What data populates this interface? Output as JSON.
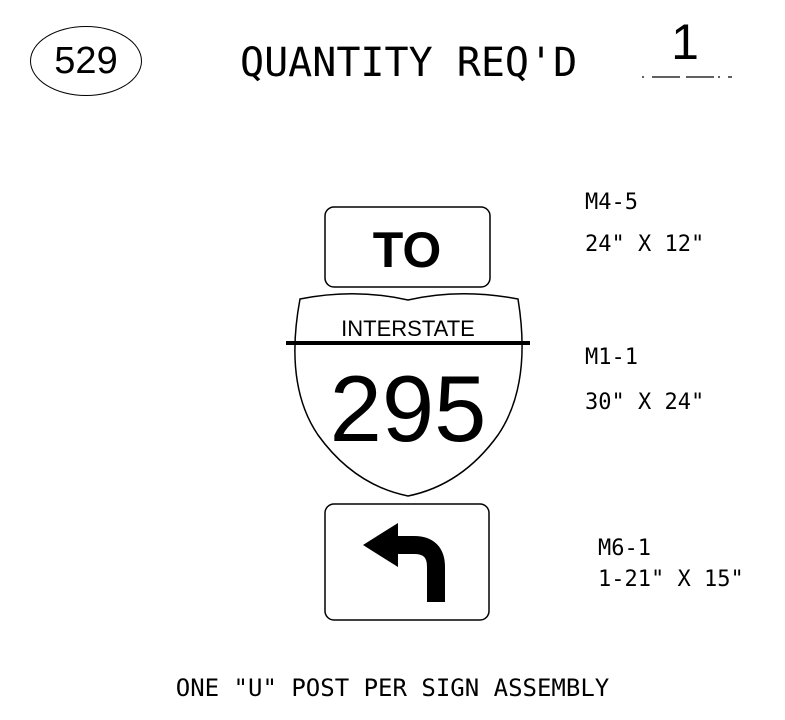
{
  "header": {
    "sign_id": "529",
    "quantity_label": "QUANTITY REQ'D",
    "quantity_value": "1"
  },
  "signs": [
    {
      "code": "M4-5",
      "size": "24\" X 12\"",
      "panel_text": "TO"
    },
    {
      "code": "M1-1",
      "size": "30\" X 24\"",
      "shield_banner": "INTERSTATE",
      "shield_number": "295"
    },
    {
      "code": "M6-1",
      "size": "1-21\" X 15\"",
      "arrow": "left-turn-arrow-icon"
    }
  ],
  "footer": {
    "note": "ONE \"U\" POST PER SIGN ASSEMBLY"
  }
}
